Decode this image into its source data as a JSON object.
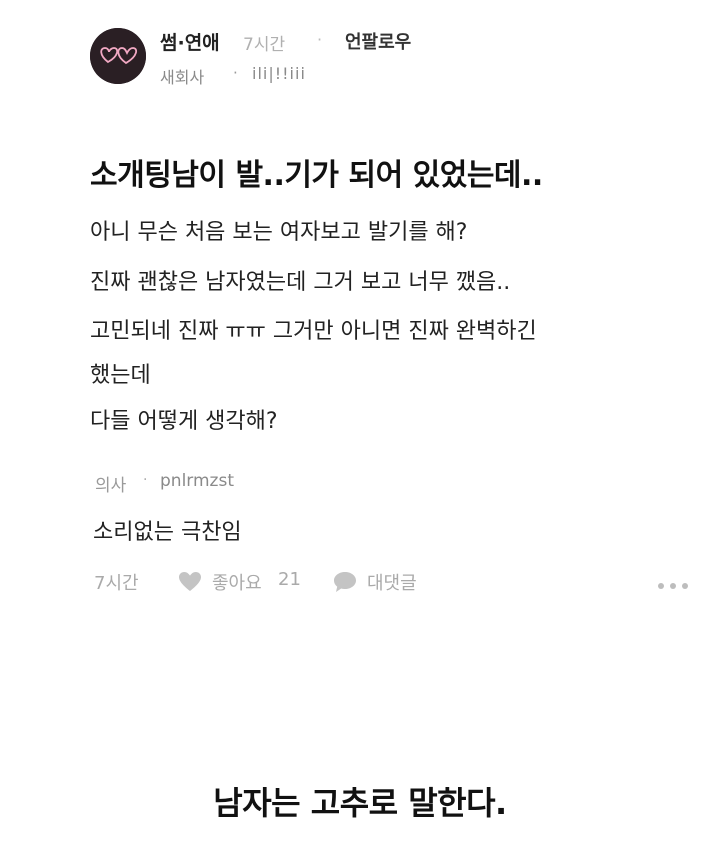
{
  "post": {
    "category": "썸·연애",
    "time": "7시간",
    "separator": "·",
    "unfollow_label": "언팔로우",
    "author_job": "새회사",
    "author_nick": "ili|!!iii",
    "title": "소개팅남이 발..기가 되어 있었는데..",
    "body_lines": [
      "아니 무슨 처음 보는 여자보고 발기를 해?",
      "진짜 괜찮은 남자였는데 그거 보고 너무 깼음..",
      "고민되네 진짜 ㅠㅠ 그거만 아니면 진짜 완벽하긴",
      "했는데",
      "다들 어떻게 생각해?"
    ]
  },
  "comment": {
    "job": "의사",
    "separator": "·",
    "nick": "pnlrmzst",
    "text": "소리없는 극찬임",
    "time": "7시간",
    "like_label": "좋아요",
    "like_count": "21",
    "reply_label": "대댓글",
    "icons": [
      "heart-icon",
      "speech-bubble-icon",
      "more-dots-icon"
    ]
  },
  "caption": "남자는 고추로 말한다.",
  "colors": {
    "text": "#222222",
    "meta": "#aaaaaa",
    "avatar_bg": "#2a1f24",
    "avatar_hearts": "#f2a9c4"
  }
}
